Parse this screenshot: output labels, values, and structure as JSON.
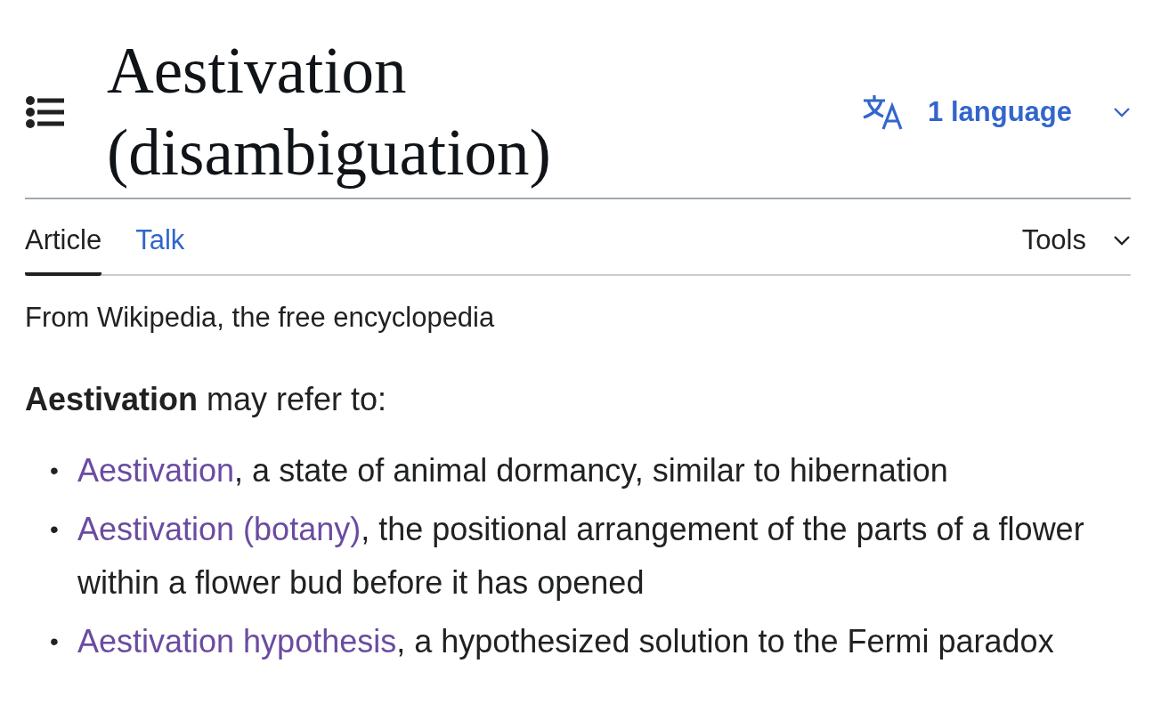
{
  "header": {
    "title": "Aestivation (disambiguation)",
    "language_button": "1 language"
  },
  "tabs": [
    {
      "label": "Article",
      "selected": true
    },
    {
      "label": "Talk",
      "selected": false
    }
  ],
  "tools": {
    "label": "Tools"
  },
  "tagline": "From Wikipedia, the free encyclopedia",
  "intro": "**Aestivation** may refer to:",
  "entries": [
    {
      "bullet": "•",
      "link": "Aestivation",
      "description": ", a state of animal dormancy, similar to hibernation"
    },
    {
      "bullet": "•",
      "link": "Aestivation (botany)",
      "description": ", the positional arrangement of the parts of a flower within a flower bud before it has opened"
    },
    {
      "bullet": "•",
      "link": "Aestivation hypothesis",
      "description": ", a hypothesized solution to the Fermi paradox"
    }
  ]
}
